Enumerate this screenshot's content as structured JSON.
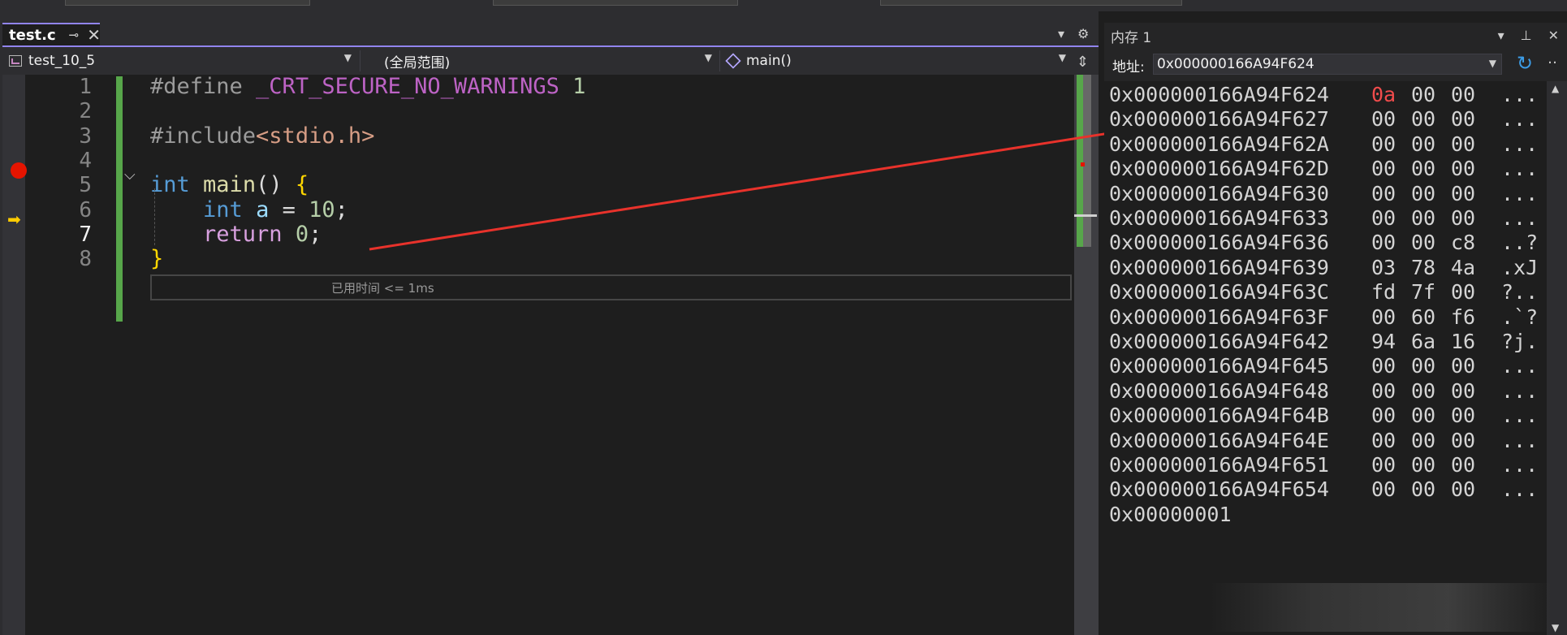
{
  "editor": {
    "tab": {
      "label": "test.c",
      "pin_icon": "pin-icon",
      "close_icon": "close-icon"
    },
    "nav": {
      "project": "test_10_5",
      "scope": "(全局范围)",
      "member": "main()"
    },
    "lines": [
      {
        "num": "1",
        "tokens": [
          {
            "t": "#define ",
            "c": "pp"
          },
          {
            "t": "_CRT_SECURE_NO_WARNINGS",
            "c": "mac"
          },
          {
            "t": " 1",
            "c": "num"
          }
        ]
      },
      {
        "num": "2",
        "tokens": []
      },
      {
        "num": "3",
        "tokens": [
          {
            "t": "#include",
            "c": "pp"
          },
          {
            "t": "<stdio.h>",
            "c": "str"
          }
        ]
      },
      {
        "num": "4",
        "tokens": []
      },
      {
        "num": "5",
        "tokens": [
          {
            "t": "int",
            "c": "kw"
          },
          {
            "t": " ",
            "c": ""
          },
          {
            "t": "main",
            "c": "fn"
          },
          {
            "t": "() ",
            "c": ""
          },
          {
            "t": "{",
            "c": "brace"
          }
        ]
      },
      {
        "num": "6",
        "tokens": [
          {
            "t": "    ",
            "c": ""
          },
          {
            "t": "int",
            "c": "kw"
          },
          {
            "t": " ",
            "c": ""
          },
          {
            "t": "a",
            "c": "var"
          },
          {
            "t": " = ",
            "c": ""
          },
          {
            "t": "10",
            "c": "num"
          },
          {
            "t": ";",
            "c": ""
          }
        ]
      },
      {
        "num": "7",
        "tokens": [
          {
            "t": "    ",
            "c": ""
          },
          {
            "t": "return",
            "c": "ctl"
          },
          {
            "t": " ",
            "c": ""
          },
          {
            "t": "0",
            "c": "num"
          },
          {
            "t": ";",
            "c": ""
          }
        ]
      },
      {
        "num": "8",
        "tokens": [
          {
            "t": "}",
            "c": "brace"
          }
        ]
      }
    ],
    "breakpoint_line": 5,
    "current_line": 7,
    "perf_tip": "已用时间 <= 1ms"
  },
  "memory": {
    "title": "内存 1",
    "address_label": "地址:",
    "address_value": "0x000000166A94F624",
    "rows": [
      {
        "addr": "0x000000166A94F624",
        "bytes": [
          "0a",
          "00",
          "00"
        ],
        "ascii": "...",
        "changed": [
          0
        ]
      },
      {
        "addr": "0x000000166A94F627",
        "bytes": [
          "00",
          "00",
          "00"
        ],
        "ascii": "...",
        "changed": []
      },
      {
        "addr": "0x000000166A94F62A",
        "bytes": [
          "00",
          "00",
          "00"
        ],
        "ascii": "...",
        "changed": []
      },
      {
        "addr": "0x000000166A94F62D",
        "bytes": [
          "00",
          "00",
          "00"
        ],
        "ascii": "...",
        "changed": []
      },
      {
        "addr": "0x000000166A94F630",
        "bytes": [
          "00",
          "00",
          "00"
        ],
        "ascii": "...",
        "changed": []
      },
      {
        "addr": "0x000000166A94F633",
        "bytes": [
          "00",
          "00",
          "00"
        ],
        "ascii": "...",
        "changed": []
      },
      {
        "addr": "0x000000166A94F636",
        "bytes": [
          "00",
          "00",
          "c8"
        ],
        "ascii": "..?",
        "changed": []
      },
      {
        "addr": "0x000000166A94F639",
        "bytes": [
          "03",
          "78",
          "4a"
        ],
        "ascii": ".xJ",
        "changed": []
      },
      {
        "addr": "0x000000166A94F63C",
        "bytes": [
          "fd",
          "7f",
          "00"
        ],
        "ascii": "?..",
        "changed": []
      },
      {
        "addr": "0x000000166A94F63F",
        "bytes": [
          "00",
          "60",
          "f6"
        ],
        "ascii": ".`?",
        "changed": []
      },
      {
        "addr": "0x000000166A94F642",
        "bytes": [
          "94",
          "6a",
          "16"
        ],
        "ascii": "?j.",
        "changed": []
      },
      {
        "addr": "0x000000166A94F645",
        "bytes": [
          "00",
          "00",
          "00"
        ],
        "ascii": "...",
        "changed": []
      },
      {
        "addr": "0x000000166A94F648",
        "bytes": [
          "00",
          "00",
          "00"
        ],
        "ascii": "...",
        "changed": []
      },
      {
        "addr": "0x000000166A94F64B",
        "bytes": [
          "00",
          "00",
          "00"
        ],
        "ascii": "...",
        "changed": []
      },
      {
        "addr": "0x000000166A94F64E",
        "bytes": [
          "00",
          "00",
          "00"
        ],
        "ascii": "...",
        "changed": []
      },
      {
        "addr": "0x000000166A94F651",
        "bytes": [
          "00",
          "00",
          "00"
        ],
        "ascii": "...",
        "changed": []
      },
      {
        "addr": "0x000000166A94F654",
        "bytes": [
          "00",
          "00",
          "00"
        ],
        "ascii": "...",
        "changed": []
      },
      {
        "addr": "0x00000001",
        "bytes": [],
        "ascii": "",
        "changed": []
      }
    ]
  },
  "colors": {
    "accent": "#9184ee",
    "breakpoint": "#e51400",
    "changed_byte": "#f14c4c",
    "arrow": "#e8322b"
  },
  "icons": [
    "pin-icon",
    "close-icon",
    "dropdown-icon",
    "settings-icon",
    "split-icon",
    "refresh-icon",
    "breakpoint-icon",
    "instruction-pointer-icon"
  ]
}
